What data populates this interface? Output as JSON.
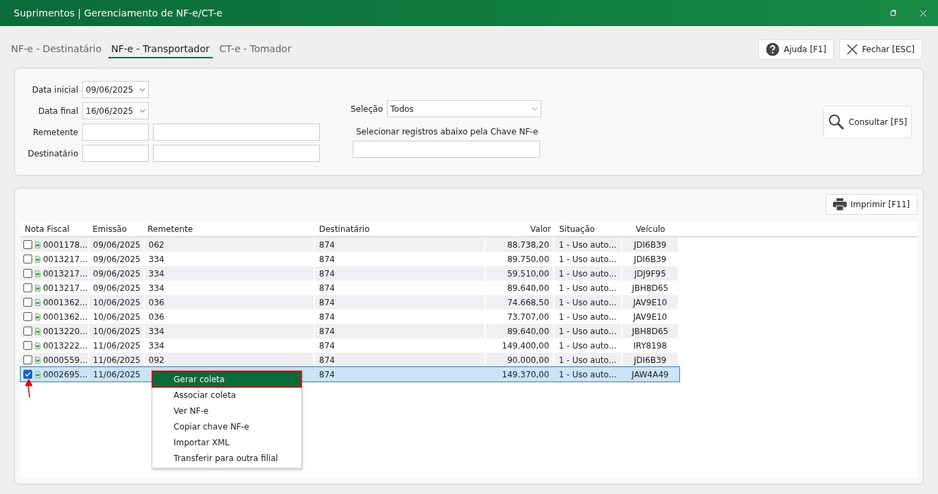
{
  "window": {
    "title": "Suprimentos | Gerenciamento de NF-e/CT-e"
  },
  "tabs": [
    {
      "label": "NF-e - Destinatário",
      "selected": false
    },
    {
      "label": "NF-e - Transportador",
      "selected": true
    },
    {
      "label": "CT-e - Tomador",
      "selected": false
    }
  ],
  "top_buttons": [
    {
      "label": "Ajuda [F1]",
      "kind": "help"
    },
    {
      "label": "Fechar [ESC]",
      "kind": "close"
    }
  ],
  "filters": {
    "data_inicial": {
      "label": "Data inicial",
      "value": "09/06/2025"
    },
    "data_final": {
      "label": "Data final",
      "value": "16/06/2025"
    },
    "remetente": {
      "label": "Remetente"
    },
    "destinatario": {
      "label": "Destinatário"
    },
    "selecao": {
      "label": "Seleção",
      "value": "Todos"
    },
    "chave": {
      "label": "Selecionar registros abaixo pela Chave NF-e"
    },
    "consultar": "Consultar [F5]"
  },
  "print_button": "Imprimir [F11]",
  "table": {
    "columns": [
      "Nota Fiscal",
      "Emissão",
      "Remetente",
      "Destinatário",
      "Valor",
      "Situação",
      "Veículo"
    ],
    "rows": [
      {
        "checked": false,
        "selected": false,
        "cells": [
          "0001178...",
          "09/06/2025",
          "062",
          "874",
          "88.738,20",
          "1 - Uso auto...",
          "JDI6B39"
        ]
      },
      {
        "checked": false,
        "selected": false,
        "cells": [
          "0013217...",
          "09/06/2025",
          "334",
          "874",
          "89.750,00",
          "1 - Uso auto...",
          "JDI6B39"
        ]
      },
      {
        "checked": false,
        "selected": false,
        "cells": [
          "0013217...",
          "09/06/2025",
          "334",
          "874",
          "59.510,00",
          "1 - Uso auto...",
          "JDJ9F95"
        ]
      },
      {
        "checked": false,
        "selected": false,
        "cells": [
          "0013217...",
          "09/06/2025",
          "334",
          "874",
          "89.640,00",
          "1 - Uso auto...",
          "JBH8D65"
        ]
      },
      {
        "checked": false,
        "selected": false,
        "cells": [
          "0001362...",
          "10/06/2025",
          "036",
          "874",
          "74.668,50",
          "1 - Uso auto...",
          "JAV9E10"
        ]
      },
      {
        "checked": false,
        "selected": false,
        "cells": [
          "0001362...",
          "10/06/2025",
          "036",
          "874",
          "73.707,00",
          "1 - Uso auto...",
          "JAV9E10"
        ]
      },
      {
        "checked": false,
        "selected": false,
        "cells": [
          "0013220...",
          "10/06/2025",
          "334",
          "874",
          "89.640,00",
          "1 - Uso auto...",
          "JBH8D65"
        ]
      },
      {
        "checked": false,
        "selected": false,
        "cells": [
          "0013222...",
          "11/06/2025",
          "334",
          "874",
          "149.400,00",
          "1 - Uso auto...",
          "IRY8198"
        ]
      },
      {
        "checked": false,
        "selected": false,
        "cells": [
          "0000559...",
          "11/06/2025",
          "092",
          "874",
          "90.000,00",
          "1 - Uso auto...",
          "JDI6B39"
        ]
      },
      {
        "checked": true,
        "selected": true,
        "cells": [
          "0002695...",
          "11/06/2025",
          null,
          "874",
          "149.370,00",
          "1 - Uso auto...",
          "JAW4A49"
        ]
      }
    ]
  },
  "context_menu": [
    {
      "label": "Gerar coleta",
      "selected": true
    },
    {
      "label": "Associar coleta",
      "selected": false
    },
    {
      "label": "Ver NF-e",
      "selected": false
    },
    {
      "label": "Copiar chave NF-e",
      "selected": false
    },
    {
      "label": "Importar XML",
      "selected": false
    },
    {
      "label": "Transferir para outra filial",
      "selected": false
    }
  ]
}
